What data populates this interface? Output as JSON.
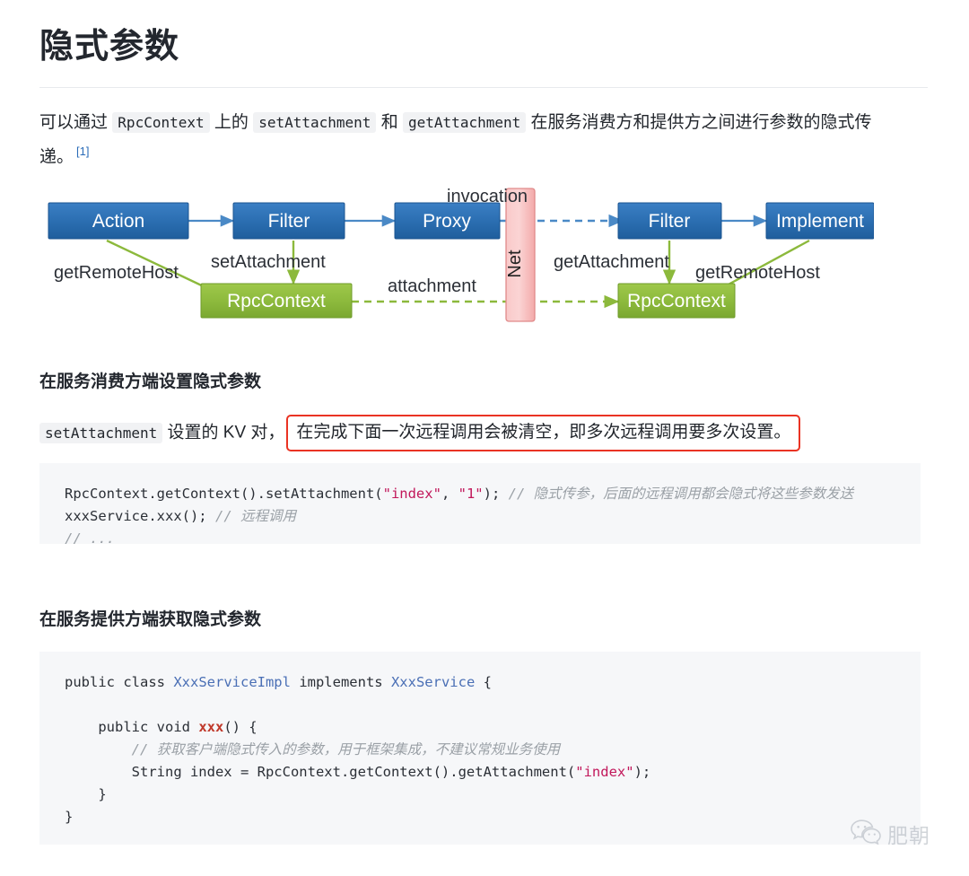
{
  "document": {
    "title": "隐式参数",
    "intro": {
      "part1": "可以通过",
      "code1": "RpcContext",
      "part2": "上的",
      "code2": "setAttachment",
      "part3": "和",
      "code3": "getAttachment",
      "part4": "在服务消费方和提供方之间进行参数的隐式传",
      "part5": "递。",
      "footnote": "[1]"
    }
  },
  "diagram": {
    "nodes": {
      "action": "Action",
      "filter_left": "Filter",
      "proxy": "Proxy",
      "net": "Net",
      "filter_right": "Filter",
      "implement": "Implement",
      "rpccontext_left": "RpcContext",
      "rpccontext_right": "RpcContext"
    },
    "labels": {
      "get_remote_host_left": "getRemoteHost",
      "set_attachment": "setAttachment",
      "invocation": "invocation",
      "attachment": "attachment",
      "get_attachment": "getAttachment",
      "get_remote_host_right": "getRemoteHost"
    },
    "colors": {
      "box_blue": "#2a6db0",
      "box_green": "#8cb93c",
      "box_pink": "#f7b6b6",
      "arrow_blue": "#4a89c6",
      "arrow_green": "#8cb93c"
    }
  },
  "sections": [
    {
      "heading": "在服务消费方端设置隐式参数",
      "note": {
        "code": "setAttachment",
        "text_before": "设置的 KV 对，",
        "highlight": "在完成下面一次远程调用会被清空，即多次远程调用要多次设置。"
      },
      "code": {
        "line1_a": "RpcContext.getContext().setAttachment(",
        "line1_str1": "\"index\"",
        "line1_b": ", ",
        "line1_str2": "\"1\"",
        "line1_c": "); ",
        "line1_comment": "// 隐式传参，后面的远程调用都会隐式将这些参数发送",
        "line2_a": "xxxService.xxx(); ",
        "line2_comment": "// 远程调用",
        "line3_comment": "// ..."
      }
    },
    {
      "heading": "在服务提供方端获取隐式参数",
      "code": {
        "l1_a": "public class ",
        "l1_type1": "XxxServiceImpl",
        "l1_b": " implements ",
        "l1_type2": "XxxService",
        "l1_c": " {",
        "l2": "",
        "l3_a": "    public void ",
        "l3_fn": "xxx",
        "l3_b": "() {",
        "l4_comment": "        // 获取客户端隐式传入的参数，用于框架集成，不建议常规业务使用",
        "l5_a": "        String index = RpcContext.getContext().getAttachment(",
        "l5_str": "\"index\"",
        "l5_b": ");",
        "l6": "    }",
        "l7": "}"
      }
    }
  ],
  "watermark": {
    "icon": "wechat-icon",
    "text": "肥朝"
  }
}
